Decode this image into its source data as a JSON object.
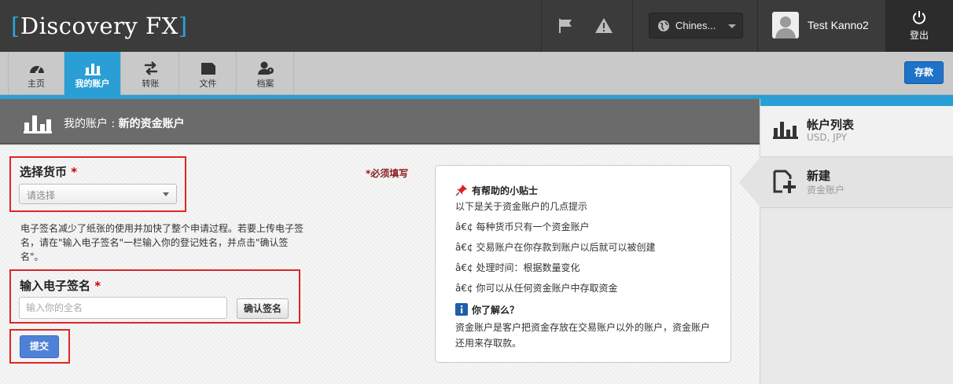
{
  "header": {
    "logo_bracket_open": "[",
    "logo_text": "Discovery FX",
    "logo_bracket_close": "]",
    "language": "Chines...",
    "username": "Test Kanno2",
    "logout_label": "登出",
    "icons": [
      "flag-icon",
      "warning-icon",
      "globe-icon",
      "user-avatar-icon",
      "power-icon"
    ]
  },
  "nav": {
    "items": [
      {
        "label": "主页",
        "icon": "dashboard-icon"
      },
      {
        "label": "我的账户",
        "icon": "bar-chart-icon",
        "active": true
      },
      {
        "label": "转账",
        "icon": "transfer-icon"
      },
      {
        "label": "文件",
        "icon": "folder-icon"
      },
      {
        "label": "档案",
        "icon": "profile-icon"
      }
    ],
    "deposit_label": "存款"
  },
  "page": {
    "crumb_prefix": "我的账户 : ",
    "crumb_title": "新的资金账户"
  },
  "form": {
    "currency_label": "选择货币",
    "required_mark": "*",
    "currency_placeholder": "请选择",
    "description": "电子签名减少了纸张的使用并加快了整个申请过程。若要上传电子签名，请在\"输入电子签名\"一栏输入你的登记姓名，并点击\"确认签名\"。",
    "signature_label": "输入电子签名",
    "signature_placeholder": "输入你的全名",
    "confirm_label": "确认签名",
    "submit_label": "提交",
    "required_note": "*必须填写"
  },
  "tips": {
    "title": "有帮助的小贴士",
    "intro": "以下是关于资金账户的几点提示",
    "bullets": [
      "â€¢ 每种货币只有一个资金账户",
      "â€¢ 交易账户在你存款到账户以后就可以被创建",
      "â€¢ 处理时间：根据数量变化",
      "â€¢ 你可以从任何资金账户中存取资金"
    ],
    "know_title": "你了解么？",
    "know_text": "资金账户是客户把资金存放在交易账户以外的账户，资金账户还用来存取款。"
  },
  "sidebar": {
    "items": [
      {
        "title": "帐户列表",
        "subtitle": "USD, JPY",
        "icon": "bar-chart-icon"
      },
      {
        "title": "新建",
        "subtitle": "资金账户",
        "icon": "add-document-icon"
      }
    ]
  },
  "colors": {
    "accent": "#2a9fd6",
    "topbar": "#3b3b3b",
    "required_red": "#c00000",
    "deposit_blue": "#1e73c9",
    "submit_blue": "#4e82d6",
    "highlight_box": "#e02424"
  }
}
